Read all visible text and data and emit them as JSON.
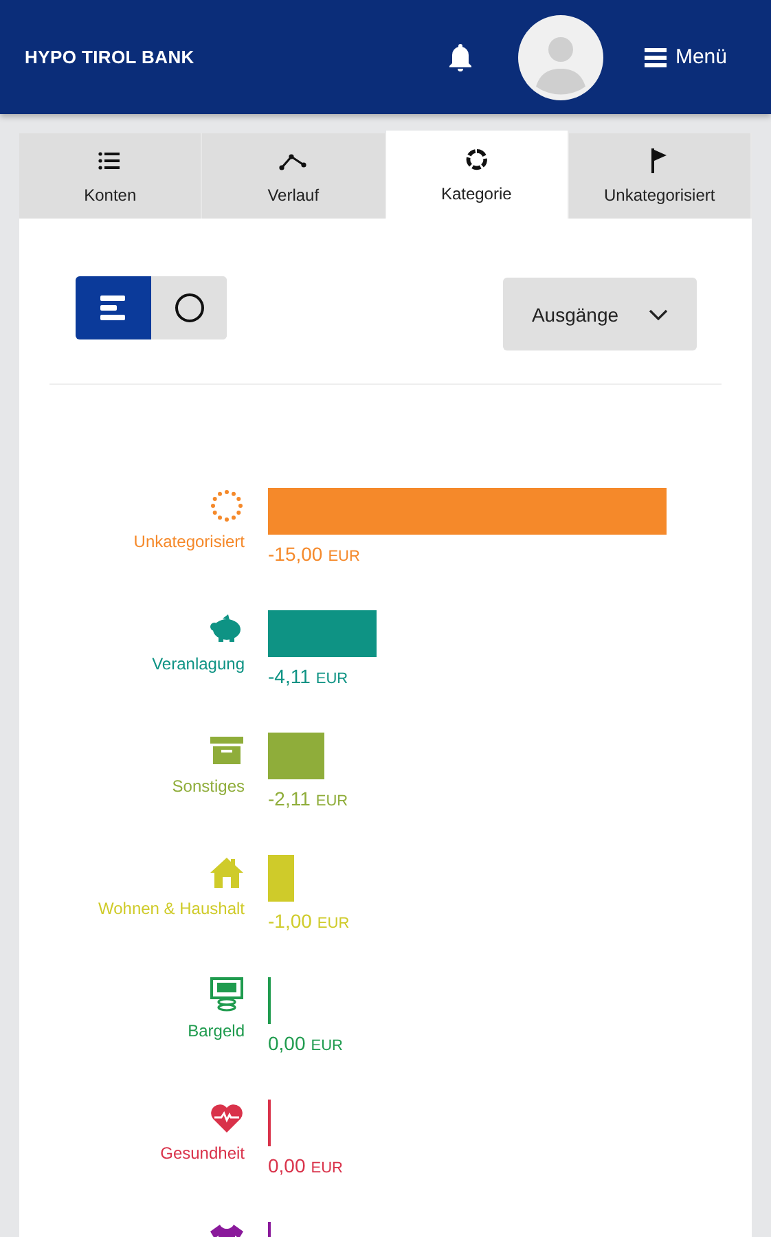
{
  "header": {
    "brand": "HYPO TIROL BANK",
    "menu_label": "Menü"
  },
  "tabs": [
    {
      "label": "Konten",
      "selected": false
    },
    {
      "label": "Verlauf",
      "selected": false
    },
    {
      "label": "Kategorie",
      "selected": true
    },
    {
      "label": "Unkategorisiert",
      "selected": false
    }
  ],
  "view_toggle": [
    {
      "selected": true
    },
    {
      "selected": false
    }
  ],
  "filter_dropdown": {
    "value": "Ausgänge"
  },
  "categories": [
    {
      "name": "Unkategorisiert",
      "color": "#f5892a",
      "level": 1,
      "amount": "-15,00",
      "currency": "EUR"
    },
    {
      "name": "Veranlagung",
      "color": "#0e9384",
      "level": 0.274,
      "amount": "-4,11",
      "currency": "EUR"
    },
    {
      "name": "Sonstiges",
      "color": "#8fad3a",
      "level": 0.141,
      "amount": "-2,11",
      "currency": "EUR"
    },
    {
      "name": "Wohnen & Haushalt",
      "color": "#cfcb2a",
      "level": 0.067,
      "amount": "-1,00",
      "currency": "EUR"
    },
    {
      "name": "Bargeld",
      "color": "#1f9b4e",
      "level": 0,
      "amount": "0,00",
      "currency": "EUR"
    },
    {
      "name": "Gesundheit",
      "color": "#d9324a",
      "level": 0,
      "amount": "0,00",
      "currency": "EUR"
    },
    {
      "color": "#8a1a9b",
      "level": 0
    }
  ]
}
